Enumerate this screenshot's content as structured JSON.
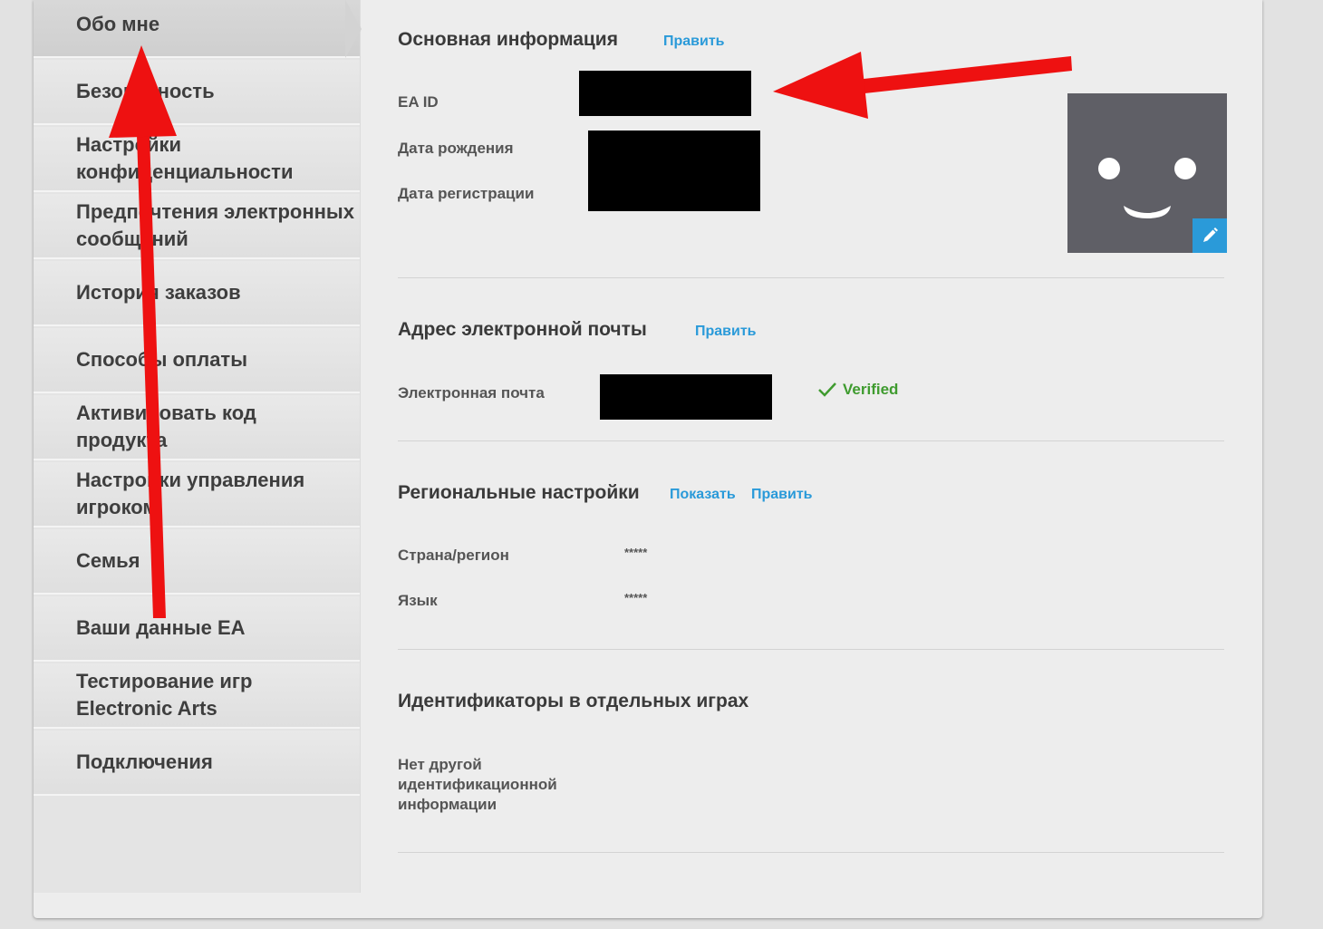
{
  "sidebar": {
    "items": [
      {
        "label": "Обо мне"
      },
      {
        "label": "Безопасность"
      },
      {
        "label": "Настройки конфиденциальности"
      },
      {
        "label": "Предпочтения электронных сообщений"
      },
      {
        "label": "История заказов"
      },
      {
        "label": "Способы оплаты"
      },
      {
        "label": "Активировать код продукта"
      },
      {
        "label": "Настройки управления игроком"
      },
      {
        "label": "Семья"
      },
      {
        "label": "Ваши данные EA"
      },
      {
        "label": "Тестирование игр Electronic Arts"
      },
      {
        "label": "Подключения"
      }
    ]
  },
  "basic_info": {
    "title": "Основная информация",
    "edit_label": "Править",
    "ea_id_label": "EA ID",
    "birth_date_label": "Дата рождения",
    "registration_date_label": "Дата регистрации"
  },
  "email_section": {
    "title": "Адрес электронной почты",
    "edit_label": "Править",
    "email_label": "Электронная почта",
    "verified_label": "Verified"
  },
  "regional": {
    "title": "Региональные настройки",
    "show_label": "Показать",
    "edit_label": "Править",
    "country_label": "Страна/регион",
    "country_value": "*****",
    "language_label": "Язык",
    "language_value": "*****"
  },
  "game_ids": {
    "title": "Идентификаторы в отдельных играх",
    "empty_text": "Нет другой идентификационной информации"
  },
  "colors": {
    "accent": "#2a9ad9",
    "verified": "#3f9b2f",
    "arrow": "#ee1111",
    "avatar_bg": "#5f5f66"
  }
}
